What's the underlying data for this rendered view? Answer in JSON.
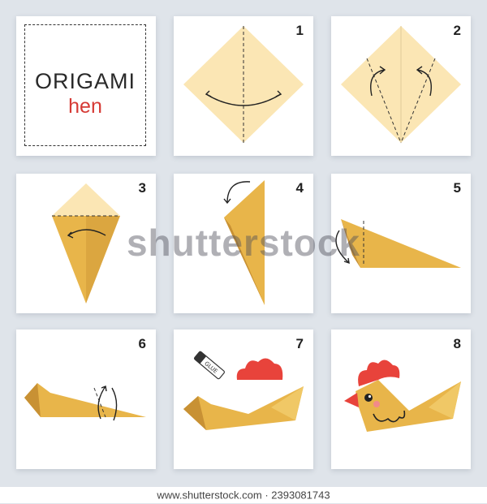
{
  "title": {
    "main": "ORIGAMI",
    "sub": "hen"
  },
  "steps": [
    "1",
    "2",
    "3",
    "4",
    "5",
    "6",
    "7",
    "8"
  ],
  "glue_label": "GLUE",
  "watermark": "shutterstock",
  "footer": {
    "site": "www.shutterstock.com",
    "separator": " · ",
    "id": "2393081743"
  },
  "colors": {
    "paper_light": "#fbe6b4",
    "paper_gold": "#e8b54a",
    "paper_dark": "#d29c33",
    "comb_red": "#e8433b",
    "background": "#dfe4ea"
  },
  "icons": [
    "fold-arrow-icon",
    "glue-stick-icon",
    "comb-icon",
    "chicken-eye-icon"
  ]
}
